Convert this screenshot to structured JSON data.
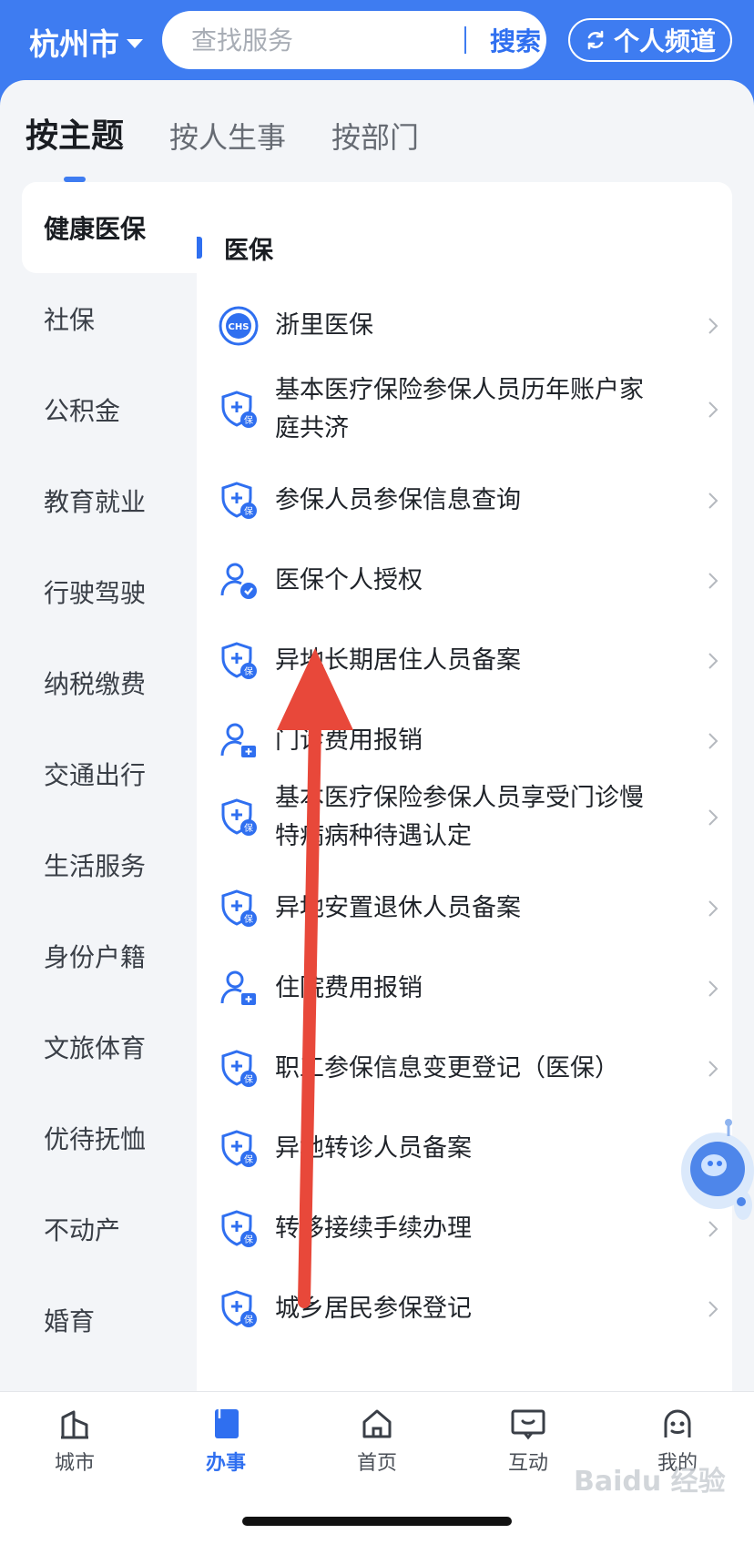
{
  "header": {
    "city": "杭州市",
    "search_placeholder": "查找服务",
    "search_button": "搜索",
    "channel_button": "个人频道"
  },
  "tabs": [
    {
      "label": "按主题",
      "active": true
    },
    {
      "label": "按人生事",
      "active": false
    },
    {
      "label": "按部门",
      "active": false
    }
  ],
  "categories": [
    "健康医保",
    "社保",
    "公积金",
    "教育就业",
    "行驶驾驶",
    "纳税缴费",
    "交通出行",
    "生活服务",
    "身份户籍",
    "文旅体育",
    "优待抚恤",
    "不动产",
    "婚育"
  ],
  "active_category": "健康医保",
  "section": {
    "title": "医保",
    "items": [
      {
        "label": "浙里医保",
        "icon": "chs-logo-icon"
      },
      {
        "label": "基本医疗保险参保人员历年账户家庭共济",
        "icon": "shield-plus-icon"
      },
      {
        "label": "参保人员参保信息查询",
        "icon": "shield-plus-icon"
      },
      {
        "label": "医保个人授权",
        "icon": "user-check-icon"
      },
      {
        "label": "异地长期居住人员备案",
        "icon": "shield-plus-icon"
      },
      {
        "label": "门诊费用报销",
        "icon": "user-medical-icon"
      },
      {
        "label": "基本医疗保险参保人员享受门诊慢特病病种待遇认定",
        "icon": "shield-plus-icon"
      },
      {
        "label": "异地安置退休人员备案",
        "icon": "shield-plus-icon"
      },
      {
        "label": "住院费用报销",
        "icon": "user-medical-icon"
      },
      {
        "label": "职工参保信息变更登记（医保）",
        "icon": "shield-plus-icon"
      },
      {
        "label": "异地转诊人员备案",
        "icon": "shield-plus-icon"
      },
      {
        "label": "转移接续手续办理",
        "icon": "shield-plus-icon"
      },
      {
        "label": "城乡居民参保登记",
        "icon": "shield-plus-icon"
      }
    ]
  },
  "bottom_nav": [
    {
      "label": "城市",
      "icon": "city-icon",
      "active": false
    },
    {
      "label": "办事",
      "icon": "book-icon",
      "active": true
    },
    {
      "label": "首页",
      "icon": "home-icon",
      "active": false
    },
    {
      "label": "互动",
      "icon": "chat-icon",
      "active": false
    },
    {
      "label": "我的",
      "icon": "profile-face-icon",
      "active": false
    }
  ],
  "watermark": "Baidu 经验",
  "colors": {
    "primary": "#3e7cf1",
    "arrow": "#e8483a"
  }
}
